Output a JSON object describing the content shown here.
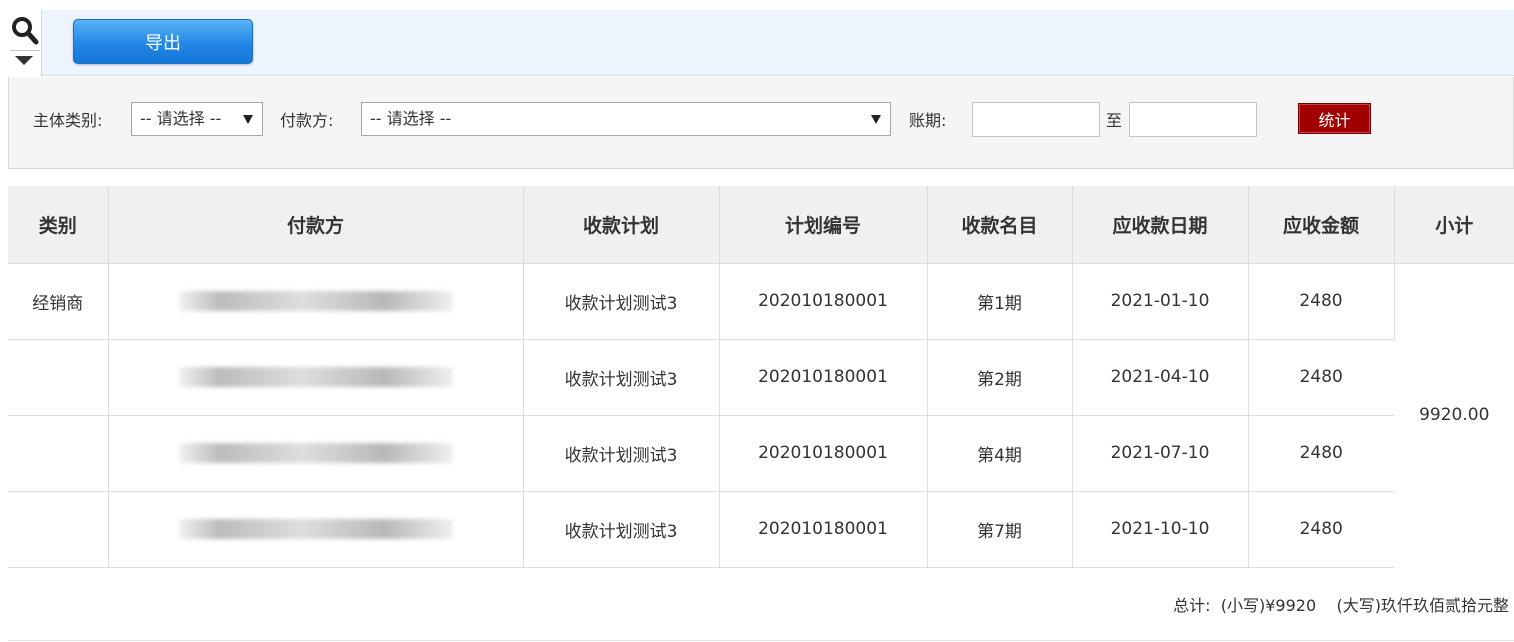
{
  "toolbar": {
    "search_icon": "search-icon",
    "toggle_icon": "caret-down-icon",
    "export_label": "导出"
  },
  "filters": {
    "subject_type_label": "主体类别:",
    "subject_type_value": "-- 请选择 --",
    "payer_label": "付款方:",
    "payer_value": "-- 请选择 --",
    "period_label": "账期:",
    "period_from": "",
    "period_to_label": "至",
    "period_to": "",
    "stat_button": "统计"
  },
  "table": {
    "headers": [
      "类别",
      "付款方",
      "收款计划",
      "计划编号",
      "收款名目",
      "应收款日期",
      "应收金额",
      "小计"
    ],
    "rows": [
      {
        "category": "经销商",
        "payer": "",
        "plan": "收款计划测试3",
        "plan_no": "202010180001",
        "item": "第1期",
        "due_date": "2021-01-10",
        "amount": "2480"
      },
      {
        "category": "",
        "payer": "",
        "plan": "收款计划测试3",
        "plan_no": "202010180001",
        "item": "第2期",
        "due_date": "2021-04-10",
        "amount": "2480"
      },
      {
        "category": "",
        "payer": "",
        "plan": "收款计划测试3",
        "plan_no": "202010180001",
        "item": "第4期",
        "due_date": "2021-07-10",
        "amount": "2480"
      },
      {
        "category": "",
        "payer": "",
        "plan": "收款计划测试3",
        "plan_no": "202010180001",
        "item": "第7期",
        "due_date": "2021-10-10",
        "amount": "2480"
      }
    ],
    "subtotal": "9920.00"
  },
  "footer": {
    "total_label": "总计:",
    "lower_label": "(小写)",
    "lower_value": "¥9920",
    "upper_label": "(大写)",
    "upper_value": "玖仟玖佰贰拾元整"
  },
  "colors": {
    "toolbar_bg": "#eef4fd",
    "export_button": "#2287e6",
    "stat_button": "#a10000",
    "header_bg": "#f0f0f0"
  }
}
